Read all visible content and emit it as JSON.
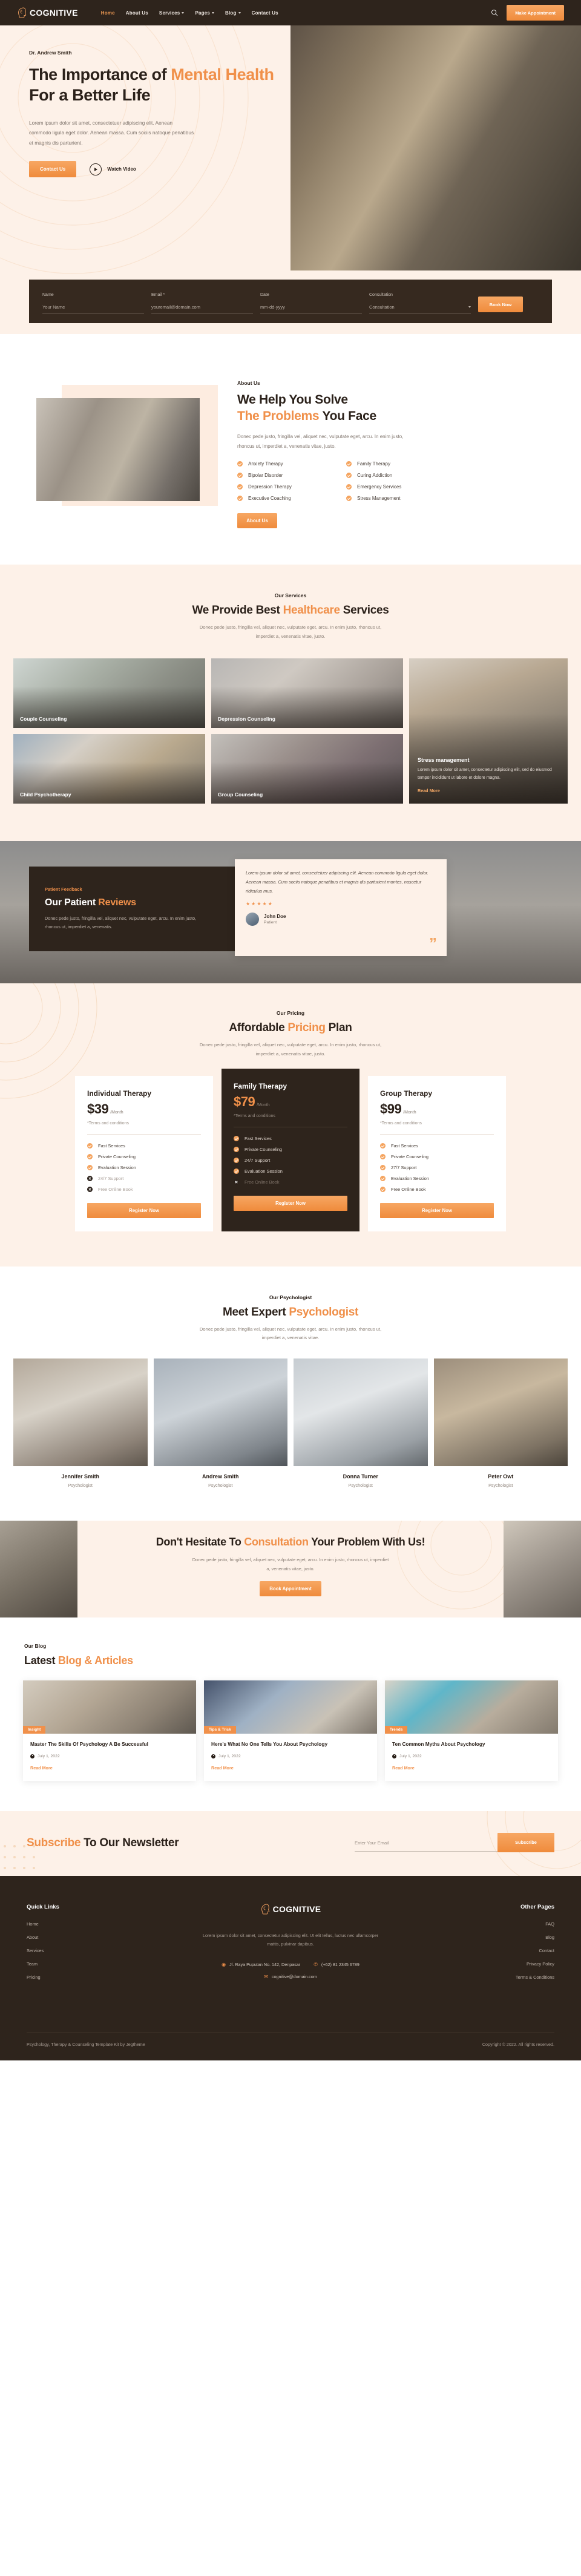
{
  "nav": {
    "brand": "COGNITIVE",
    "brand_icon": "head-profile-icon",
    "links": [
      {
        "label": "Home",
        "active": true,
        "caret": false
      },
      {
        "label": "About Us",
        "active": false,
        "caret": false
      },
      {
        "label": "Services",
        "active": false,
        "caret": true
      },
      {
        "label": "Pages",
        "active": false,
        "caret": true
      },
      {
        "label": "Blog",
        "active": false,
        "caret": true
      },
      {
        "label": "Contact Us",
        "active": false,
        "caret": false
      }
    ],
    "search_icon": "search-icon",
    "appointment_button": "Make Appointment"
  },
  "hero": {
    "eyebrow": "Dr. Andrew Smith",
    "title_1": "The Importance of ",
    "title_hl": "Mental Health",
    "title_2": " For a Better Life",
    "description": "Lorem ipsum dolor sit amet, consectetuer adipiscing elit. Aenean commodo ligula eget dolor. Aenean massa. Cum sociis natoque penatibus et magnis dis parturient.",
    "contact_button": "Contact Us",
    "watch_label": "Watch Video",
    "play_icon": "play-icon"
  },
  "booking": {
    "fields": [
      {
        "label": "Name",
        "value": "Your Name",
        "type": "text"
      },
      {
        "label": "Email *",
        "value": "youremail@domain.com",
        "type": "email"
      },
      {
        "label": "Date",
        "value": "mm-dd-yyyy",
        "type": "date"
      },
      {
        "label": "Consultation",
        "value": "Consultation",
        "type": "select"
      }
    ],
    "submit": "Book Now"
  },
  "about": {
    "eyebrow": "About Us",
    "title_1": "We Help You Solve",
    "title_hl": "The Problems",
    "title_2": " You Face",
    "description": "Donec pede justo, fringilla vel, aliquet nec, vulputate eget, arcu. In enim justo, rhoncus ut, imperdiet a, venenatis vitae, justo.",
    "features_left": [
      "Anxiety Therapy",
      "Bipolar Disorder",
      "Depression Therapy",
      "Executive Coaching"
    ],
    "features_right": [
      "Family Therapy",
      "Curing Addiction",
      "Emergency Services",
      "Stress Management"
    ],
    "button": "About Us"
  },
  "services": {
    "eyebrow": "Our Services",
    "title_1": "We Provide Best ",
    "title_hl": "Healthcare",
    "title_2": " Services",
    "subtitle": "Donec pede justo, fringilla vel, aliquet nec, vulputate eget, arcu. In enim justo, rhoncus ut, imperdiet a, venenatis vitae, justo.",
    "cards": [
      {
        "title": "Couple Counseling"
      },
      {
        "title": "Depression Counseling"
      },
      {
        "title": "Child Psychotherapy"
      },
      {
        "title": "Group Counseling"
      }
    ],
    "feature": {
      "title": "Stress management",
      "description": "Lorem ipsum dolor sit amet, consectetur adipiscing elit, sed do eiusmod tempor incididunt ut labore et dolore magna.",
      "read_more": "Read More"
    }
  },
  "reviews": {
    "eyebrow": "Patient Feedback",
    "title_1": "Our Patient ",
    "title_hl": "Reviews",
    "description": "Donec pede justo, fringilla vel, aliquet nec, vulputate eget, arcu. In enim justo, rhoncus ut, imperdiet a, venenatis.",
    "quote": "Lorem ipsum dolor sit amet, consectetuer adipiscing elit. Aenean commodo ligula eget dolor. Aenean massa. Cum sociis natoque penatibus et magnis dis parturient montes, nascetur ridiculus mus.",
    "stars": "★★★★★",
    "rating": 5,
    "author_name": "John Doe",
    "author_role": "Patient",
    "quote_mark": "”"
  },
  "pricing": {
    "eyebrow": "Our Pricing",
    "title_1": "Affordable ",
    "title_hl": "Pricing",
    "title_2": " Plan",
    "subtitle": "Donec pede justo, fringilla vel, aliquet nec, vulputate eget, arcu. In enim justo, rhoncus ut, imperdiet a, venenatis vitae, justo.",
    "plans": [
      {
        "name": "Individual Therapy",
        "amount": "$39",
        "per": "/Month",
        "terms": "*Terms and conditions",
        "features": [
          {
            "label": "Fast Services",
            "included": true
          },
          {
            "label": "Private Counseling",
            "included": true
          },
          {
            "label": "Evaluation Session",
            "included": true
          },
          {
            "label": "24/7 Support",
            "included": false
          },
          {
            "label": "Free Online Book",
            "included": false
          }
        ],
        "button": "Register Now",
        "highlight": false
      },
      {
        "name": "Family Therapy",
        "amount": "$79",
        "per": "/Month",
        "terms": "*Terms and conditions",
        "features": [
          {
            "label": "Fast Services",
            "included": true
          },
          {
            "label": "Private Counseling",
            "included": true
          },
          {
            "label": "24/7 Support",
            "included": true
          },
          {
            "label": "Evaluation Session",
            "included": true
          },
          {
            "label": "Free Online Book",
            "included": false
          }
        ],
        "button": "Register Now",
        "highlight": true
      },
      {
        "name": "Group Therapy",
        "amount": "$99",
        "per": "/Month",
        "terms": "*Terms and conditions",
        "features": [
          {
            "label": "Fast Services",
            "included": true
          },
          {
            "label": "Private Counseling",
            "included": true
          },
          {
            "label": "27/7 Support",
            "included": true
          },
          {
            "label": "Evaluation Session",
            "included": true
          },
          {
            "label": "Free Online Book",
            "included": true
          }
        ],
        "button": "Register Now",
        "highlight": false
      }
    ]
  },
  "team": {
    "eyebrow": "Our Psychologist",
    "title_1": "Meet Expert ",
    "title_hl": "Psychologist",
    "subtitle": "Donec pede justo, fringilla vel, aliquet nec, vulputate eget, arcu. In enim justo, rhoncus ut, imperdiet a, venenatis vitae.",
    "members": [
      {
        "name": "Jennifer Smith",
        "role": "Psychologist"
      },
      {
        "name": "Andrew Smith",
        "role": "Psychologist"
      },
      {
        "name": "Donna Turner",
        "role": "Psychologist"
      },
      {
        "name": "Peter Owt",
        "role": "Psychologist"
      }
    ]
  },
  "cta": {
    "title_1": "Don't Hesitate To ",
    "title_hl": "Consultation",
    "title_2": " Your Problem With Us!",
    "description": "Donec pede justo, fringilla vel, aliquet nec, vulputate eget, arcu. In enim justo, rhoncus ut, imperdiet a, venenatis vitae, justo.",
    "button": "Book Appointment"
  },
  "blog": {
    "eyebrow": "Our Blog",
    "title_1": "Latest ",
    "title_hl": "Blog & Articles",
    "posts": [
      {
        "tag": "Insight",
        "title": "Master The Skills Of Psychology A Be Successful",
        "date": "July 1, 2022",
        "read_more": "Read More"
      },
      {
        "tag": "Tips & Trick",
        "title": "Here's What No One Tells You About Psychology",
        "date": "July 1, 2022",
        "read_more": "Read More"
      },
      {
        "tag": "Trends",
        "title": "Ten Common Myths About Psychology",
        "date": "July 1, 2022",
        "read_more": "Read More"
      }
    ]
  },
  "newsletter": {
    "title_hl": "Subscribe",
    "title_rest": " To Our Newsletter",
    "placeholder": "Enter Your Email",
    "value": "",
    "button": "Subscribe"
  },
  "footer": {
    "quick_links_heading": "Quick Links",
    "quick_links": [
      "Home",
      "About",
      "Services",
      "Team",
      "Pricing"
    ],
    "other_pages_heading": "Other Pages",
    "other_pages": [
      "FAQ",
      "Blog",
      "Contact",
      "Privacy Policy",
      "Terms & Conditions"
    ],
    "brand": "COGNITIVE",
    "description": "Lorem ipsum dolor sit amet, consectetur adipiscing elit. Ut elit tellus, luctus nec ullamcorper mattis, pulvinar dapibus.",
    "address": "Jl. Raya Puputan No. 142, Denpasar",
    "phone": "(+62) 81 2345 6789",
    "email": "cognitive@domain.com",
    "location_icon": "map-pin-icon",
    "phone_icon": "phone-icon",
    "email_icon": "envelope-icon",
    "credit": "Psychology, Therapy & Counseling Template Kit by Jegtheme",
    "copyright": "Copyright © 2022. All rights reserved."
  },
  "colors": {
    "accent": "#f0904a",
    "dark": "#2e241c",
    "cream": "#fdf1e8"
  }
}
